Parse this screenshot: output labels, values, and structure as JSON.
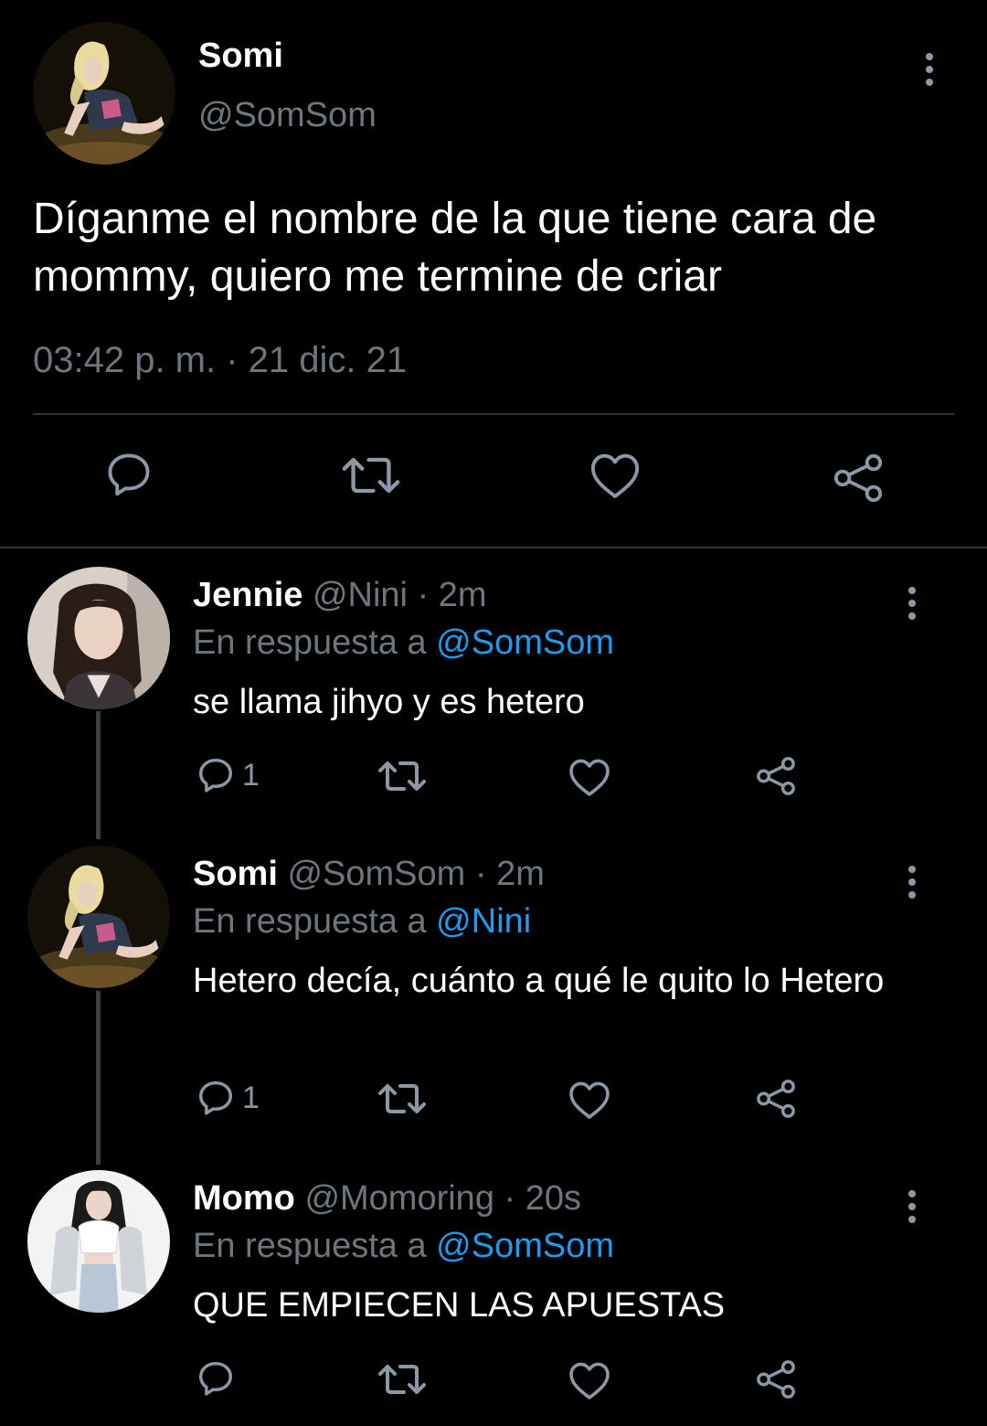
{
  "main_tweet": {
    "author_name": "Somi",
    "author_handle": "@SomSom",
    "text": "Díganme el nombre de la que tiene cara de mommy, quiero me termine de criar",
    "timestamp": "03:42 p. m. · 21 dic. 21",
    "actions": [
      "reply-icon",
      "retweet-icon",
      "like-icon",
      "share-icon"
    ]
  },
  "replies": [
    {
      "name": "Jennie",
      "handle": "@Nini",
      "time": "2m",
      "reply_prefix": "En respuesta a",
      "reply_to": "@SomSom",
      "text": "se llama jihyo y es hetero",
      "reply_count": "1"
    },
    {
      "name": "Somi",
      "handle": "@SomSom",
      "time": "2m",
      "reply_prefix": "En respuesta a",
      "reply_to": "@Nini",
      "text": "Hetero decía, cuánto a qué le quito lo Hetero",
      "reply_count": "1"
    },
    {
      "name": "Momo",
      "handle": "@Momoring",
      "time": "20s",
      "reply_prefix": "En respuesta a",
      "reply_to": "@SomSom",
      "text": "QUE EMPIECEN LAS APUESTAS",
      "reply_count": ""
    }
  ],
  "colors": {
    "background": "#000000",
    "text_primary": "#ffffff",
    "text_secondary": "#6e767d",
    "mention": "#1d9bf0",
    "icon": "#8b98a5",
    "divider": "#2f3336"
  }
}
